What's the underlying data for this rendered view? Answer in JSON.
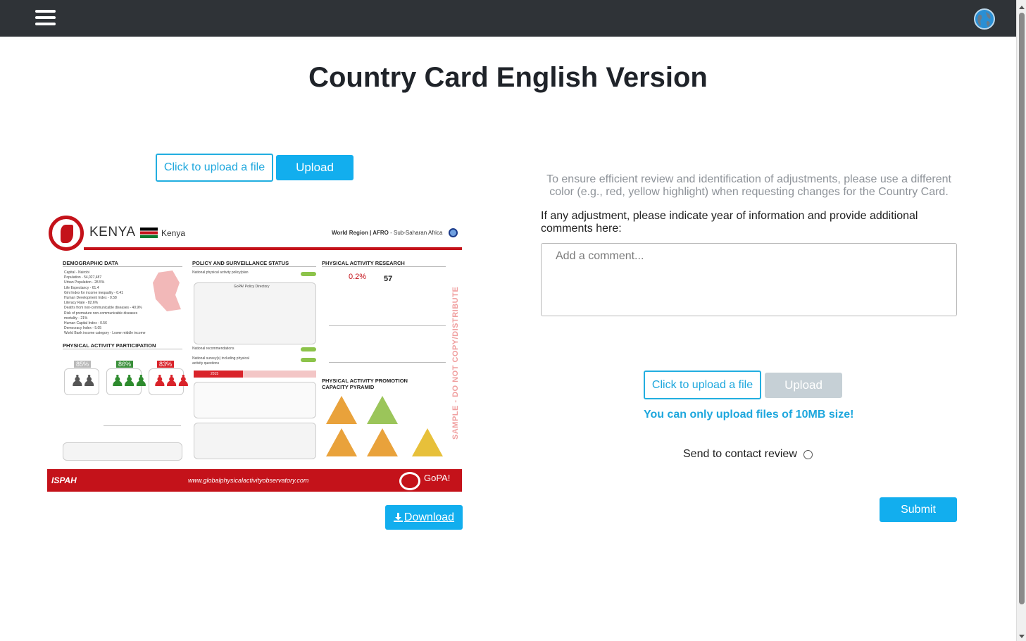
{
  "header": {
    "menu_icon": "hamburger-menu-icon",
    "globe_icon": "globe-language-icon"
  },
  "page": {
    "title": "Country Card English Version"
  },
  "left_upload": {
    "choose_label": "Click to upload a file",
    "upload_label": "Upload"
  },
  "card_preview": {
    "country": "KENYA",
    "country_small": "Kenya",
    "region_bold": "World Region | AFRO",
    "region_rest": " - Sub-Saharan Africa",
    "sections": {
      "demographic": "DEMOGRAPHIC DATA",
      "policy": "POLICY AND SURVEILLANCE STATUS",
      "research": "PHYSICAL ACTIVITY RESEARCH",
      "participation": "PHYSICAL ACTIVITY PARTICIPATION",
      "promotion": "PHYSICAL ACTIVITY PROMOTION",
      "pyramid": "CAPACITY PYRAMID"
    },
    "demographic_lines": [
      "Capital - Nairobi",
      "Population - 54,027,487",
      "Urban Population - 28.5%",
      "Life Expectancy - 61.4",
      "Gini Index for income inequality - 0.41",
      "Human Development Index - 0.58",
      "Literacy Rate - 82.6%",
      "Deaths from non-communicable diseases - 40.9%",
      "Risk of premature non-communicable diseases",
      "mortality - 21%",
      "Human Capital Index - 0.56",
      "Democracy Index - 5.05",
      "World Bank income category - Lower middle income"
    ],
    "policy_lines": [
      "National physical activity policy/plan",
      "GoPA! Policy Directory",
      "National recommendations",
      "National survey(s) including physical",
      "activity questions"
    ],
    "participation_pcts": [
      "85%",
      "86%",
      "83%"
    ],
    "research_pct": "0.2%",
    "research_rank": "57",
    "year_text": "2015",
    "watermark": "SAMPLE - DO NOT COPY/DISTRIBUTE",
    "footer_org": "ISPAH",
    "footer_url": "www.globalphysicalactivityobservatory.com",
    "footer_brand": "GoPA!"
  },
  "download": {
    "label": "Download",
    "icon": "download-icon"
  },
  "right_panel": {
    "note": "To ensure efficient review and identification of adjustments, please use a different color (e.g., red, yellow highlight) when requesting changes for the Country Card.",
    "adjust_label": "If any adjustment, please indicate year of information and provide additional comments here:",
    "comment_placeholder": "Add a comment...",
    "choose_label": "Click to upload a file",
    "upload_label": "Upload",
    "size_note": "You can only upload files of 10MB size!",
    "contact_label": "Send to contact review",
    "submit_label": "Submit"
  },
  "colors": {
    "topbar": "#2f3337",
    "accent": "#12aeee",
    "card_red": "#c4121a",
    "disabled": "#c6d0d6"
  }
}
